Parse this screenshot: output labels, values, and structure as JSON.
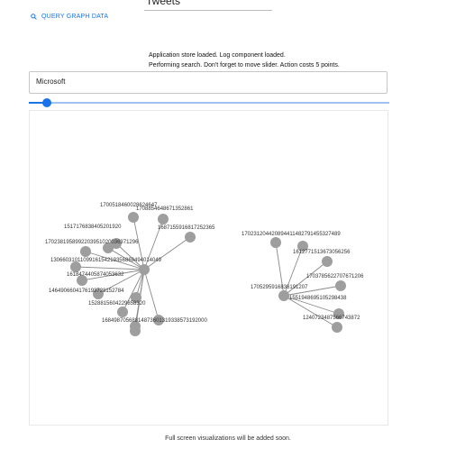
{
  "tabs": {
    "active_label": "Tweets"
  },
  "query_link": {
    "label": "QUERY GRAPH DATA",
    "icon": "search-icon"
  },
  "status": {
    "line1": "Application store loaded. Log component loaded.",
    "line2": "Performing search. Don't forget to move slider. Action costs 5 points."
  },
  "search": {
    "value": "Microsoft"
  },
  "slider": {
    "value": 0.05
  },
  "graph": {
    "node_color": "#9e9e9e",
    "edge_color": "#8a8a8a",
    "labels": [
      "1700518460028624647",
      "1708854648671352861",
      "1517176838405201920",
      "1687155916817252365",
      "1702381958992203951020036371296",
      "1306603101109916154219356869494014049",
      "1618474405874053632",
      "1464906604176193728152784",
      "1528815604229858320",
      "16849870568814873601319338573192000",
      "170231204420894411482791455327489",
      "1612771513673056256",
      "1703785622707671206",
      "1705295916836191207",
      "1551948695105298438",
      "1240723487566743872"
    ]
  },
  "footer": {
    "text": "Full screen visualizations will be added soon."
  }
}
